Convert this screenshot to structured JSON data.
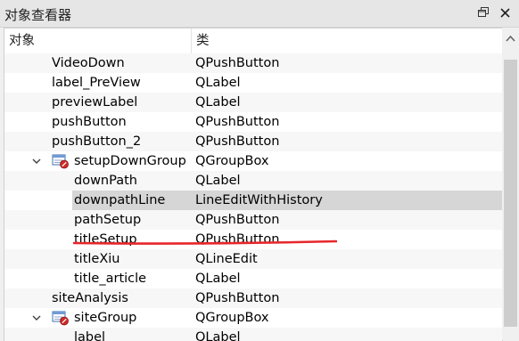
{
  "window": {
    "title": "对象查看器",
    "buttons": {
      "float_icon": "restore-icon",
      "close_icon": "close-icon"
    }
  },
  "tree": {
    "columns": {
      "object": "对象",
      "class": "类"
    },
    "rows": [
      {
        "name": "VideoDown",
        "class": "QPushButton",
        "level": 1
      },
      {
        "name": "label_PreView",
        "class": "QLabel",
        "level": 1
      },
      {
        "name": "previewLabel",
        "class": "QLabel",
        "level": 1
      },
      {
        "name": "pushButton",
        "class": "QPushButton",
        "level": 1
      },
      {
        "name": "pushButton_2",
        "class": "QPushButton",
        "level": 1
      },
      {
        "name": "setupDownGroup",
        "class": "QGroupBox",
        "level": 1,
        "expanded": true,
        "icon": "groupbox-icon"
      },
      {
        "name": "downPath",
        "class": "QLabel",
        "level": 2
      },
      {
        "name": "downpathLine",
        "class": "LineEditWithHistory",
        "level": 2,
        "selected": true
      },
      {
        "name": "pathSetup",
        "class": "QPushButton",
        "level": 2
      },
      {
        "name": "titleSetup",
        "class": "QPushButton",
        "level": 2
      },
      {
        "name": "titleXiu",
        "class": "QLineEdit",
        "level": 2
      },
      {
        "name": "title_article",
        "class": "QLabel",
        "level": 2
      },
      {
        "name": "siteAnalysis",
        "class": "QPushButton",
        "level": 1
      },
      {
        "name": "siteGroup",
        "class": "QGroupBox",
        "level": 1,
        "expanded": true,
        "icon": "groupbox-icon"
      },
      {
        "name": "label",
        "class": "QLabel",
        "level": 2
      }
    ]
  },
  "annotation": {
    "color": "#e8262a"
  },
  "colors": {
    "selection": "#d6d6d6",
    "alt_row": "#f7f7f7",
    "scroll_thumb": "#cdcdcd"
  }
}
